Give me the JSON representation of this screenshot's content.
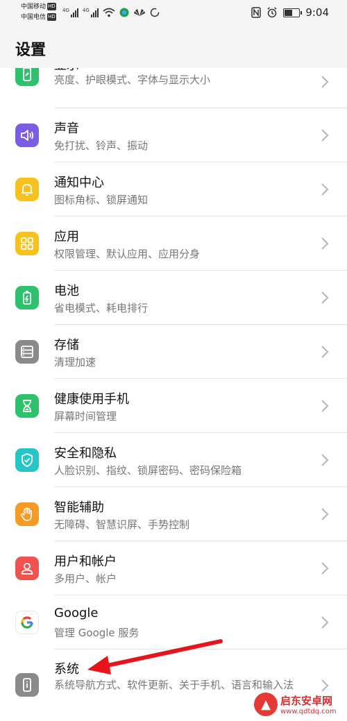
{
  "status_bar": {
    "carrier_1": "中国移动",
    "carrier_2": "中国电信",
    "hd": "HD",
    "net_1": "4G",
    "net_2": "4G",
    "time": "9:04",
    "battery_level": 0.6
  },
  "header": {
    "title": "设置"
  },
  "items": [
    {
      "title": "显示",
      "subtitle": "亮度、护眼模式、字体与显示大小",
      "icon": "display-icon",
      "color": "#2dc26b"
    },
    {
      "title": "声音",
      "subtitle": "免打扰、铃声、振动",
      "icon": "speaker-icon",
      "color": "#7b5ce5"
    },
    {
      "title": "通知中心",
      "subtitle": "图标角标、锁屏通知",
      "icon": "bell-icon",
      "color": "#f7c21b"
    },
    {
      "title": "应用",
      "subtitle": "权限管理、默认应用、应用分身",
      "icon": "apps-grid-icon",
      "color": "#f7c21b"
    },
    {
      "title": "电池",
      "subtitle": "省电模式、耗电排行",
      "icon": "battery-charge-icon",
      "color": "#2dc26b"
    },
    {
      "title": "存储",
      "subtitle": "清理加速",
      "icon": "storage-icon",
      "color": "#8a8a8a"
    },
    {
      "title": "健康使用手机",
      "subtitle": "屏幕时间管理",
      "icon": "hourglass-icon",
      "color": "#2dc26b"
    },
    {
      "title": "安全和隐私",
      "subtitle": "人脸识别、指纹、锁屏密码、密码保险箱",
      "icon": "shield-check-icon",
      "color": "#26c6c6"
    },
    {
      "title": "智能辅助",
      "subtitle": "无障碍、智慧识屏、手势控制",
      "icon": "hand-icon",
      "color": "#f59a23"
    },
    {
      "title": "用户和帐户",
      "subtitle": "多用户、帐户",
      "icon": "user-icon",
      "color": "#f0524f"
    },
    {
      "title": "Google",
      "subtitle": "管理 Google 服务",
      "icon": "google-icon",
      "color": "#ffffff"
    },
    {
      "title": "系统",
      "subtitle": "系统导航方式、软件更新、关于手机、语言和输入法",
      "icon": "phone-info-icon",
      "color": "#8a8a8a"
    }
  ],
  "watermark": {
    "name": "启东安卓网",
    "url": "www.qdtdq.com"
  },
  "colors": {
    "accent_arrow": "#e8141b",
    "chevron": "#b5b5b5",
    "divider": "#e4e4e4"
  }
}
